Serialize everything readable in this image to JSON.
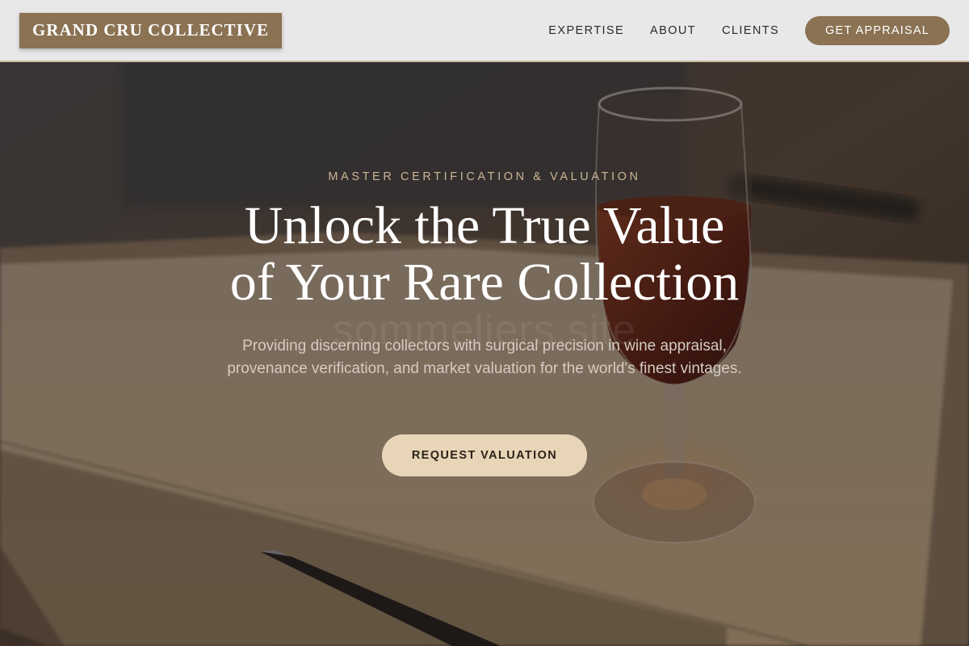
{
  "brand": {
    "name": "GRAND CRU COLLECTIVE",
    "accent": "#8a7253",
    "cream": "#e8d5b7"
  },
  "nav": {
    "links": [
      "EXPERTISE",
      "ABOUT",
      "CLIENTS"
    ],
    "cta": "GET APPRAISAL"
  },
  "hero": {
    "eyebrow": "MASTER CERTIFICATION & VALUATION",
    "headline_line1": "Unlock the True Value",
    "headline_line2": "of Your Rare Collection",
    "watermark": "sommeliers.site",
    "subtext": "Providing discerning collectors with surgical precision in wine appraisal, provenance verification, and market valuation for the world's finest vintages.",
    "cta": "REQUEST VALUATION",
    "background_image": "wine-glass-on-notebook-with-pen"
  }
}
